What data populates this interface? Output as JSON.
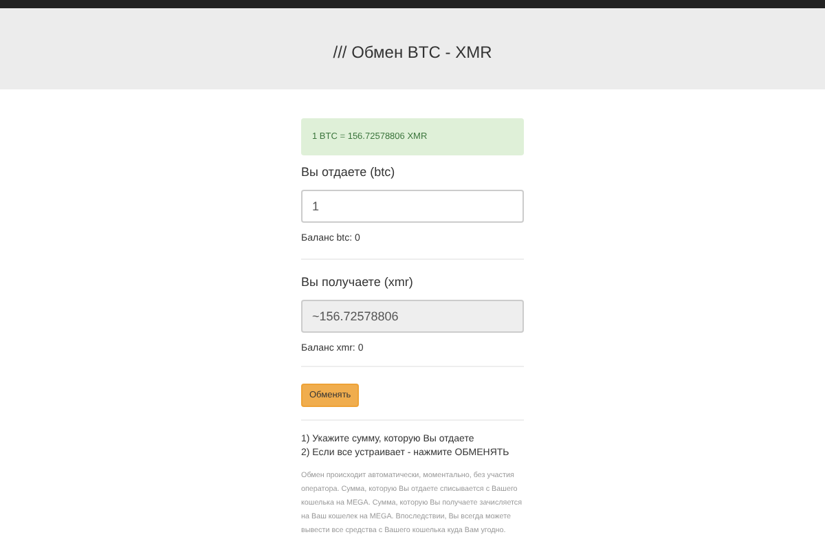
{
  "header": {
    "title": "/// Обмен BTC - XMR"
  },
  "rate": "1 BTC = 156.72578806 XMR",
  "give": {
    "label": "Вы отдаете (btc)",
    "value": "1",
    "balance": "Баланс btc: 0",
    "disabled": false
  },
  "receive": {
    "label": "Вы получаете (xmr)",
    "value": "~156.72578806",
    "balance": "Баланс xmr: 0",
    "disabled": true
  },
  "button": "Обменять",
  "steps": [
    "1) Укажите сумму, которую Вы отдаете",
    "2) Если все устраивает - нажмите ОБМЕНЯТЬ"
  ],
  "note": "Обмен происходит автоматически, моментально, без участия оператора. Сумма, которую Вы отдаете списывается с Вашего кошелька на MEGA. Сумма, которую Вы получаете зачисляется на Ваш кошелек на MEGA. Впоследствии, Вы всегда можете вывести все средства с Вашего кошелька куда Вам угодно."
}
